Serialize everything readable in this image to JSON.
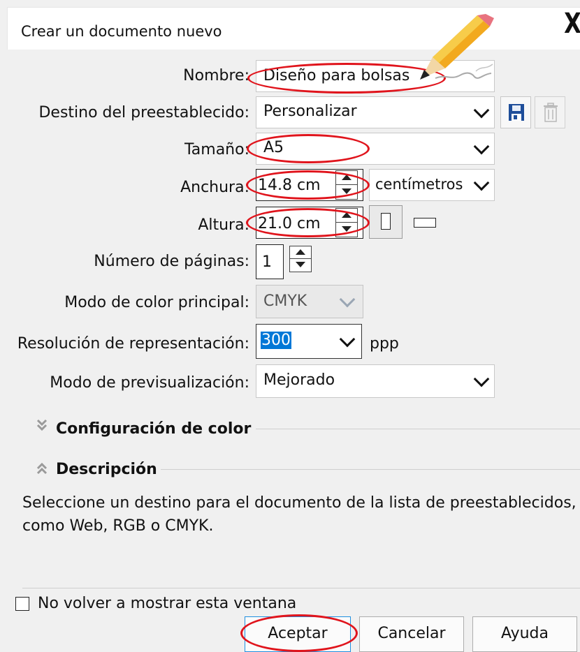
{
  "window": {
    "title": "Crear un documento nuevo",
    "close_label": "X"
  },
  "form": {
    "name": {
      "label": "Nombre:",
      "value": "Diseño para bolsas"
    },
    "preset": {
      "label": "Destino del preestablecido:",
      "value": "Personalizar"
    },
    "size": {
      "label": "Tamaño:",
      "value": "A5"
    },
    "width": {
      "label": "Anchura:",
      "value": "14.8 cm",
      "unit": "centímetros"
    },
    "height": {
      "label": "Altura:",
      "value": "21.0 cm"
    },
    "pages": {
      "label": "Número de páginas:",
      "value": "1"
    },
    "color_mode": {
      "label": "Modo de color principal:",
      "value": "CMYK"
    },
    "resolution": {
      "label": "Resolución de representación:",
      "value": "300",
      "unit": "ppp"
    },
    "preview": {
      "label": "Modo de previsualización:",
      "value": "Mejorado"
    }
  },
  "sections": {
    "color_settings": "Configuración de color",
    "description": "Descripción"
  },
  "description_text": "Seleccione un destino para el documento de la lista de preestablecidos, como Web, RGB o CMYK.",
  "footer": {
    "dont_show": "No volver a mostrar esta ventana",
    "accept": "Aceptar",
    "cancel": "Cancelar",
    "help": "Ayuda"
  },
  "colors": {
    "highlight_oval": "#e0141c",
    "selection": "#0078d7",
    "save_icon": "#1f4e9a"
  }
}
